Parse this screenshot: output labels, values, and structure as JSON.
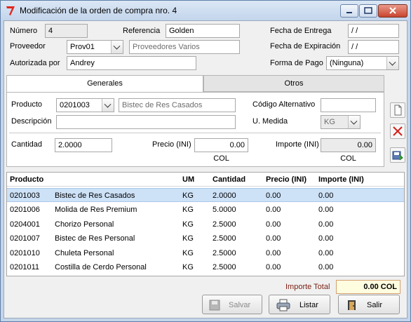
{
  "window": {
    "title": "Modificación de la orden de compra nro. 4"
  },
  "header": {
    "numero_label": "Número",
    "numero_value": "4",
    "referencia_label": "Referencia",
    "referencia_value": "Golden",
    "fecha_entrega_label": "Fecha de Entrega",
    "fecha_entrega_value": "/ /",
    "proveedor_label": "Proveedor",
    "proveedor_code": "Prov01",
    "proveedor_name": "Proveedores Varios",
    "fecha_expiracion_label": "Fecha de Expiración",
    "fecha_expiracion_value": "/ /",
    "autorizada_label": "Autorizada por",
    "autorizada_value": "Andrey",
    "forma_pago_label": "Forma de Pago",
    "forma_pago_value": "(Ninguna)"
  },
  "tabs": [
    {
      "label": "Generales",
      "active": true
    },
    {
      "label": "Otros",
      "active": false
    }
  ],
  "detail": {
    "producto_label": "Producto",
    "producto_code": "0201003",
    "producto_name": "Bistec de Res Casados",
    "codigo_alt_label": "Código Alternativo",
    "codigo_alt_value": "",
    "descripcion_label": "Descripción",
    "descripcion_value": "",
    "medida_label": "U. Medida",
    "medida_value": "KG",
    "cantidad_label": "Cantidad",
    "cantidad_value": "2.0000",
    "precio_label": "Precio (INI)",
    "precio_value": "0.00",
    "precio_unit": "COL",
    "importe_label": "Importe (INI)",
    "importe_value": "0.00",
    "importe_unit": "COL"
  },
  "side_buttons": {
    "new_icon": "new-document-icon",
    "delete_icon": "delete-x-icon",
    "save_icon": "save-disk-icon"
  },
  "grid": {
    "columns": [
      "Producto",
      "",
      "UM",
      "Cantidad",
      "Precio (INI)",
      "Importe (INI)"
    ],
    "rows": [
      {
        "code": "0201003",
        "name": "Bistec de Res Casados",
        "um": "KG",
        "cantidad": "2.0000",
        "precio": "0.00",
        "importe": "0.00",
        "selected": true
      },
      {
        "code": "0201006",
        "name": "Molida de Res Premium",
        "um": "KG",
        "cantidad": "5.0000",
        "precio": "0.00",
        "importe": "0.00"
      },
      {
        "code": "0204001",
        "name": "Chorizo Personal",
        "um": "KG",
        "cantidad": "2.5000",
        "precio": "0.00",
        "importe": "0.00"
      },
      {
        "code": "0201007",
        "name": "Bistec de Res Personal",
        "um": "KG",
        "cantidad": "2.5000",
        "precio": "0.00",
        "importe": "0.00"
      },
      {
        "code": "0201010",
        "name": "Chuleta Personal",
        "um": "KG",
        "cantidad": "2.5000",
        "precio": "0.00",
        "importe": "0.00"
      },
      {
        "code": "0201011",
        "name": "Costilla de Cerdo Personal",
        "um": "KG",
        "cantidad": "2.5000",
        "precio": "0.00",
        "importe": "0.00"
      }
    ]
  },
  "footer": {
    "importe_total_label": "Importe Total",
    "importe_total_value": "0.00 COL",
    "salvar_label": "Salvar",
    "listar_label": "Listar",
    "salir_label": "Salir"
  },
  "colors": {
    "label_red": "#7a1f12",
    "total_bg": "#fffde0",
    "total_border": "#d4a070",
    "selection": "#cde1f7"
  }
}
